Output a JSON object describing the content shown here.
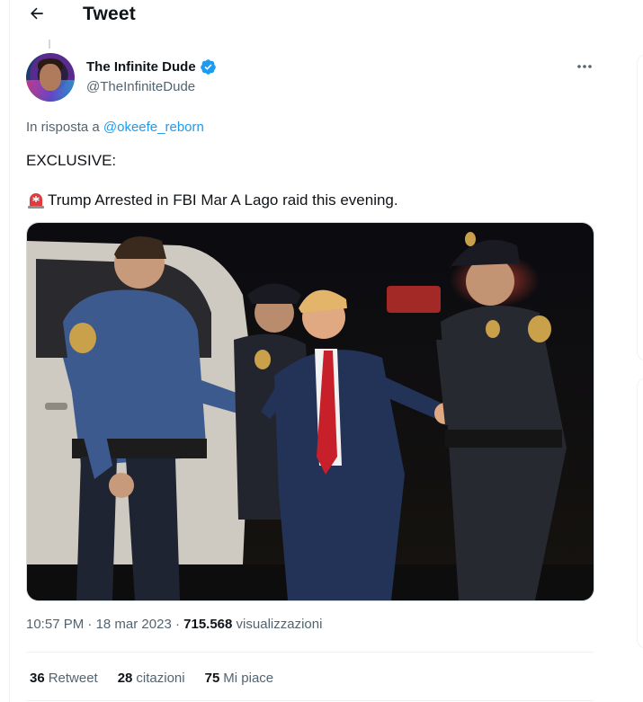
{
  "header": {
    "title": "Tweet"
  },
  "author": {
    "name": "The Infinite Dude",
    "handle": "@TheInfiniteDude",
    "verified_color": "#1d9bf0"
  },
  "reply": {
    "prefix": "In risposta a",
    "mention": "@okeefe_reborn"
  },
  "tweet": {
    "line1": "EXCLUSIVE:",
    "line2": "Trump Arrested in FBI Mar A Lago raid this evening."
  },
  "meta": {
    "time": "10:57 PM",
    "date": "18 mar 2023",
    "views_count": "715.568",
    "views_label": "visualizzazioni"
  },
  "stats": {
    "retweets_count": "36",
    "retweets_label": "Retweet",
    "quotes_count": "28",
    "quotes_label": "citazioni",
    "likes_count": "75",
    "likes_label": "Mi piace"
  },
  "icons": [
    "back-arrow-icon",
    "verified-badge-icon",
    "more-options-icon",
    "siren-emoji-icon"
  ],
  "colors": {
    "link": "#1d9bf0",
    "secondary": "#536471",
    "text": "#0f1419"
  }
}
